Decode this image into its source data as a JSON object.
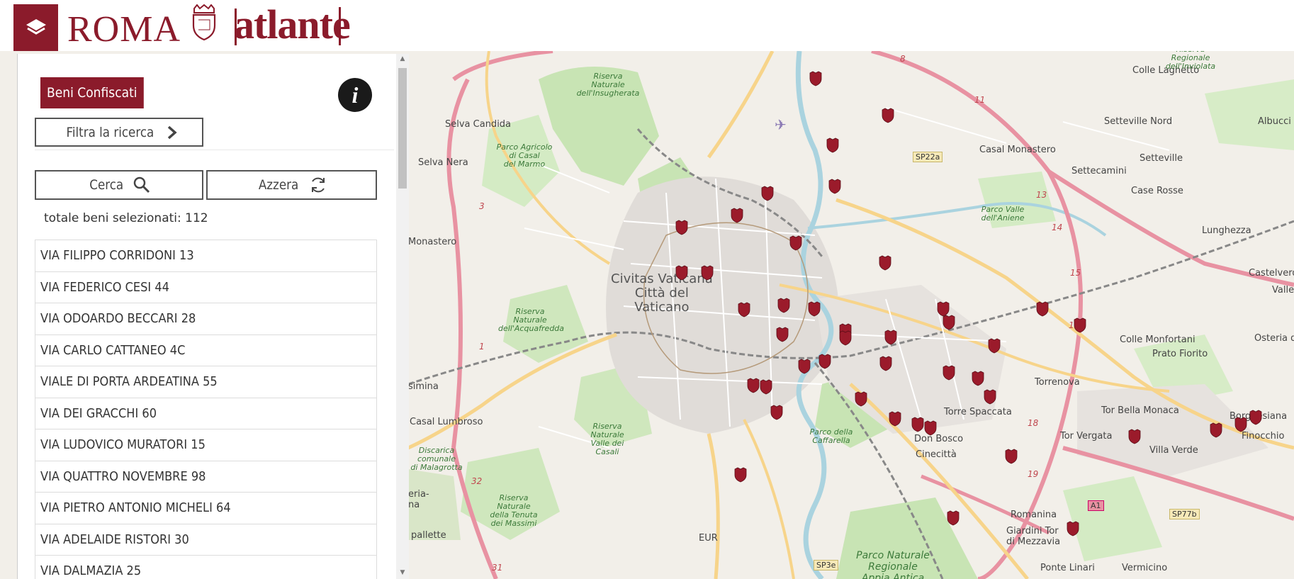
{
  "header": {
    "brand": "ROMA",
    "product": "atlante",
    "logo_icon": "layers-icon",
    "crest_icon": "spqr-crest-icon",
    "colors": {
      "brand": "#8b1b2b"
    }
  },
  "panel": {
    "title": "Beni Confiscati",
    "info_icon": "info-icon",
    "filter_label": "Filtra la ricerca",
    "search_label": "Cerca",
    "reset_label": "Azzera",
    "total_text": "totale beni selezionati: 112",
    "results": [
      "VIA FILIPPO CORRIDONI 13",
      "VIA FEDERICO CESI 44",
      "VIA ODOARDO BECCARI 28",
      "VIA CARLO CATTANEO 4C",
      "VIALE DI PORTA ARDEATINA 55",
      "VIA DEI GRACCHI 60",
      "VIA LUDOVICO MURATORI 15",
      "VIA QUATTRO NOVEMBRE 98",
      "VIA PIETRO ANTONIO MICHELI 64",
      "VIA ADELAIDE RISTORI 30",
      "VIA DALMAZIA 25"
    ]
  },
  "map": {
    "marker_color": "#9b1b2b",
    "labels": {
      "colle_laghetto": "Colle Laghetto",
      "selva_candida": "Selva Candida",
      "selva_nera": "Selva Nera",
      "monastero": "Monastero",
      "civitas": "Civitas Vaticana\nCittà del\nVaticano",
      "casal_monastero": "Casal Monastero",
      "setteville_nord": "Setteville Nord",
      "setteville": "Setteville",
      "settecamini": "Settecamini",
      "case_rosse": "Case Rosse",
      "lunghezza": "Lunghezza",
      "albuccione": "Albucci",
      "castelverde": "Castelverde",
      "valle": "Valle",
      "colle_monfortani": "Colle Monfortani",
      "osteria": "Osteria d",
      "prato_fiorito": "Prato Fiorito",
      "torrenova": "Torrenova",
      "torre_spaccata": "Torre Spaccata",
      "tor_bella_monaca": "Tor Bella Monaca",
      "borghesiana": "Borghesiana",
      "tor_vergata": "Tor Vergata",
      "villa_verde": "Villa Verde",
      "finocchio": "Finocchio",
      "don_bosco": "Don Bosco",
      "cinecitta": "Cinecittà",
      "romanina": "Romanina",
      "giardini": "Giardini Tor\ndi Mezzavia",
      "ponte_linari": "Ponte Linari",
      "vermicino": "Vermicino",
      "eur": "EUR",
      "casal_lumbroso": "Casal Lumbroso",
      "pallette": "pallette",
      "simina": "simina",
      "eria": "eria-\nna",
      "sp22a": "SP22a",
      "sp77b": "SP77b",
      "sp3e": "SP3e",
      "a1": "A1",
      "riserva_insugherata": "Riserva\nNaturale\ndell'Insugherata",
      "parco_casal_marmo": "Parco Agricolo\ndi Casal\ndel Marmo",
      "riserva_acquafredda": "Riserva\nNaturale\ndell'Acquafredda",
      "riserva_galeria": "Riserva\nNaturale\nValle dei\nCasali",
      "discarica": "Discarica\ncomunale\ndi Malagrotta",
      "riserva_tenuta": "Riserva\nNaturale\ndella Tenuta\ndei Massimi",
      "parco_caffarella": "Parco della\nCaffarella",
      "parco_aniene": "Parco Valle\ndell'Aniene",
      "parco_regionale": "Parco Naturale\nRegionale\nAppia Antica",
      "inviolata": "Riserva\nRegionale\ndell'Inviolata"
    }
  }
}
